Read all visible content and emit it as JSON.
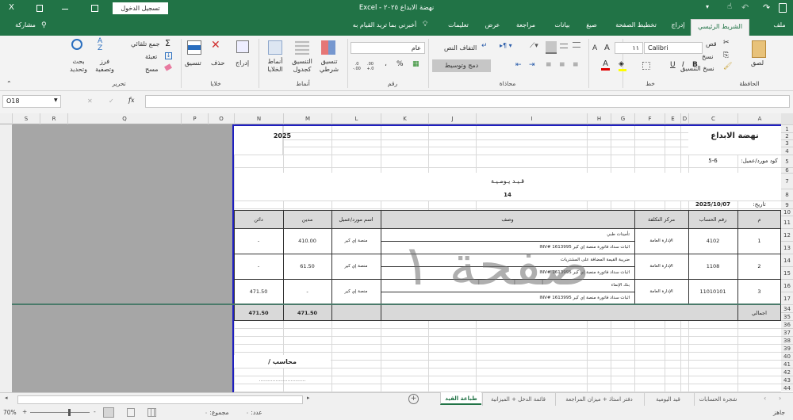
{
  "title_bar": {
    "title": "نهضة الابداع ٢٠٢٥ - Excel",
    "sign_in": "تسجيل الدخول",
    "close_glyph": "X",
    "qat_more": "▾"
  },
  "tabs": [
    "ملف",
    "الشريط الرئيسي",
    "إدراج",
    "تخطيط الصفحة",
    "صيغ",
    "بيانات",
    "مراجعة",
    "عرض",
    "تعليمات"
  ],
  "tell_me": "أخبرني بما تريد القيام به",
  "share": "مشاركة",
  "ribbon": {
    "clipboard": {
      "label": "الحافظة",
      "paste": "لصق",
      "cut": "قص",
      "copy": "نسخ",
      "format_painter": "نسخ التنسيق"
    },
    "font": {
      "label": "خط",
      "font_name": "Calibri",
      "font_size": "١١",
      "bold": "B",
      "italic": "I",
      "underline": "U",
      "grow": "A",
      "shrink": "A",
      "color": "A"
    },
    "alignment": {
      "label": "محاذاة",
      "wrap": "التفاف النص",
      "merge": "دمج وتوسيط"
    },
    "number": {
      "label": "رقم",
      "format": "عام",
      "percent": "%",
      "comma": "،",
      "inc_dec": ".00 +.0",
      "dec_dec": ".0 -.00"
    },
    "styles": {
      "label": "أنماط",
      "conditional": "تنسيق شرطي",
      "as_table": "التنسيق كجدول",
      "cell_styles": "أنماط الخلايا"
    },
    "cells": {
      "label": "خلايا",
      "insert": "إدراج",
      "delete": "حذف",
      "format": "تنسيق"
    },
    "editing": {
      "label": "تحرير",
      "autosum": "جمع تلقائي",
      "fill": "تعبئة",
      "clear": "مسح",
      "sort": "فرز وتصفية",
      "find": "بحث وتحديد"
    }
  },
  "formula_bar": {
    "name_box": "O18",
    "cancel": "✕",
    "enter": "✓",
    "fx": "fx",
    "value": ""
  },
  "columns": [
    {
      "l": "A"
    },
    {
      "l": "C"
    },
    {
      "l": "D"
    },
    {
      "l": "E"
    },
    {
      "l": "F"
    },
    {
      "l": "G"
    },
    {
      "l": "H"
    },
    {
      "l": "I"
    },
    {
      "l": "J"
    },
    {
      "l": "K"
    },
    {
      "l": "L"
    },
    {
      "l": "M"
    },
    {
      "l": "N"
    },
    {
      "l": "O"
    },
    {
      "l": "P"
    },
    {
      "l": "Q"
    },
    {
      "l": "R"
    },
    {
      "l": "S"
    }
  ],
  "rows": [
    "1",
    "2",
    "3",
    "4",
    "5",
    "6",
    "7",
    "8",
    "9",
    "10",
    "11",
    "12",
    "13",
    "14",
    "15",
    "16",
    "17",
    "34",
    "35",
    "36",
    "37",
    "38",
    "39",
    "40",
    "41",
    "42",
    "43",
    "44"
  ],
  "sheet": {
    "company": "نهضة الابداع",
    "year": "2025",
    "code_label": "كود مورد/عميل:",
    "code_value": "5-6",
    "doc_title": "قـيـد يـومـيـة",
    "doc_number": "14",
    "date_label": "تاريخ:",
    "date_value": "2025/10/07",
    "headers": {
      "no": "م",
      "account": "رقم الحساب",
      "cost_center": "مركز التكلفة",
      "description": "وصف",
      "party": "اسم مورد/عميل",
      "debit": "مدين",
      "credit": "دائن"
    },
    "entries": [
      {
        "no": "1",
        "account": "4102",
        "cost_center": "الإدارة العامة",
        "desc1": "تأمينات طبي",
        "desc2": "اثبات سداد فاتورة منصة إي كير INV# 1613995",
        "party": "منصة إي كير",
        "debit": "410.00",
        "credit": "-"
      },
      {
        "no": "2",
        "account": "1108",
        "cost_center": "الإدارة العامة",
        "desc1": "ضريبة القيمة المضافة على المشتريات",
        "desc2": "اثبات سداد فاتورة منصة إي كير INV# 1613995",
        "party": "منصة إي كير",
        "debit": "61.50",
        "credit": "-"
      },
      {
        "no": "3",
        "account": "11010101",
        "cost_center": "الإدارة العامة",
        "desc1": "بنك الإنماء",
        "desc2": "اثبات سداد فاتورة منصة إي كير INV# 1613995",
        "party": "منصة إي كير",
        "debit": "-",
        "credit": "471.50"
      }
    ],
    "total_label": "اجمالي",
    "total_debit": "471.50",
    "total_credit": "471.50",
    "signature": "محاسب /",
    "signature_line": "...............................",
    "watermark": "صفحة ١"
  },
  "sheet_tabs": [
    "شجرة الحسابات",
    "قيد اليومية",
    "دفتر استاذ + ميزان المراجعة",
    "قائمة الدخل + الميزانية",
    "طباعة القيد"
  ],
  "add_sheet": "+",
  "status": {
    "ready": "جاهز",
    "count": "عدد: ٠",
    "sum": "مجموع: ٠",
    "zoom": "70%"
  },
  "colors": {
    "excel_green": "#217346",
    "page_gray": "#a6a6a6",
    "page_border": "#1f1fbf"
  }
}
